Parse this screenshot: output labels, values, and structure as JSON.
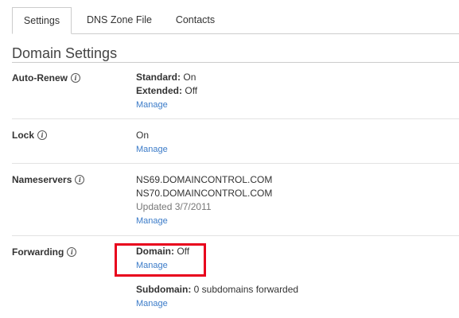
{
  "tabs": [
    {
      "label": "Settings",
      "active": true
    },
    {
      "label": "DNS Zone File",
      "active": false
    },
    {
      "label": "Contacts",
      "active": false
    }
  ],
  "section": {
    "title": "Domain Settings"
  },
  "info_icon_glyph": "i",
  "rows": {
    "auto_renew": {
      "label": "Auto-Renew",
      "standard_key": "Standard:",
      "standard_value": "On",
      "extended_key": "Extended:",
      "extended_value": "Off",
      "manage": "Manage"
    },
    "lock": {
      "label": "Lock",
      "value": "On",
      "manage": "Manage"
    },
    "nameservers": {
      "label": "Nameservers",
      "ns1": "NS69.DOMAINCONTROL.COM",
      "ns2": "NS70.DOMAINCONTROL.COM",
      "updated": "Updated 3/7/2011",
      "manage": "Manage"
    },
    "forwarding": {
      "label": "Forwarding",
      "domain_key": "Domain:",
      "domain_value": "Off",
      "domain_manage": "Manage",
      "subdomain_key": "Subdomain:",
      "subdomain_value": "0 subdomains forwarded",
      "subdomain_manage": "Manage"
    }
  },
  "colors": {
    "link": "#3b7bc8",
    "highlight": "#e8001c"
  }
}
